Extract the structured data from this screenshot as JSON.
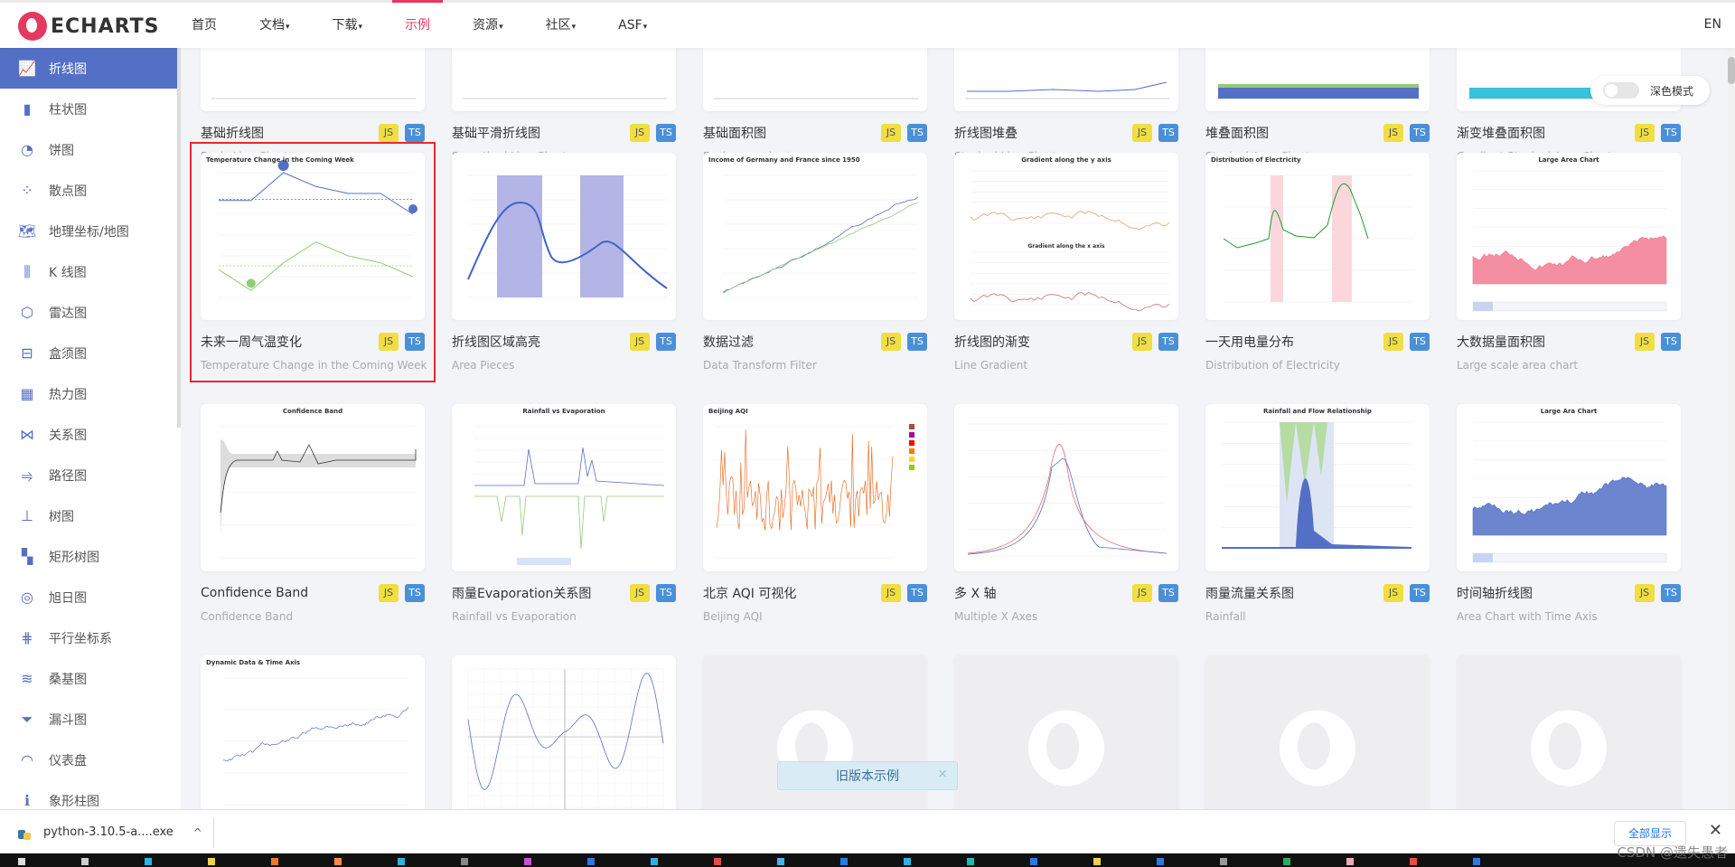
{
  "topbar": {
    "logo_text": "ECHARTS",
    "nav": [
      {
        "label": "首页",
        "caret": ""
      },
      {
        "label": "文档",
        "caret": "▾"
      },
      {
        "label": "下载",
        "caret": "▾"
      },
      {
        "label": "示例",
        "caret": "",
        "active": true
      },
      {
        "label": "资源",
        "caret": "▾"
      },
      {
        "label": "社区",
        "caret": "▾"
      },
      {
        "label": "ASF",
        "caret": "▾"
      }
    ],
    "lang": "EN"
  },
  "sidebar": {
    "items": [
      {
        "label": "折线图",
        "icon": "line-chart-icon",
        "glyph": "📈",
        "active": true
      },
      {
        "label": "柱状图",
        "icon": "bar-chart-icon",
        "glyph": "▮"
      },
      {
        "label": "饼图",
        "icon": "pie-chart-icon",
        "glyph": "◔"
      },
      {
        "label": "散点图",
        "icon": "scatter-chart-icon",
        "glyph": "⁘"
      },
      {
        "label": "地理坐标/地图",
        "icon": "map-icon",
        "glyph": "🗺"
      },
      {
        "label": "K 线图",
        "icon": "candlestick-icon",
        "glyph": "⫼"
      },
      {
        "label": "雷达图",
        "icon": "radar-icon",
        "glyph": "⬡"
      },
      {
        "label": "盒须图",
        "icon": "boxplot-icon",
        "glyph": "⊟"
      },
      {
        "label": "热力图",
        "icon": "heatmap-icon",
        "glyph": "▦"
      },
      {
        "label": "关系图",
        "icon": "graph-icon",
        "glyph": "⋈"
      },
      {
        "label": "路径图",
        "icon": "lines-icon",
        "glyph": "⥤"
      },
      {
        "label": "树图",
        "icon": "tree-icon",
        "glyph": "⊥"
      },
      {
        "label": "矩形树图",
        "icon": "treemap-icon",
        "glyph": "▚"
      },
      {
        "label": "旭日图",
        "icon": "sunburst-icon",
        "glyph": "◎"
      },
      {
        "label": "平行坐标系",
        "icon": "parallel-icon",
        "glyph": "⋕"
      },
      {
        "label": "桑基图",
        "icon": "sankey-icon",
        "glyph": "≋"
      },
      {
        "label": "漏斗图",
        "icon": "funnel-icon",
        "glyph": "⏷"
      },
      {
        "label": "仪表盘",
        "icon": "gauge-icon",
        "glyph": "◠"
      },
      {
        "label": "象形柱图",
        "icon": "pictorial-bar-icon",
        "glyph": "ℹ"
      }
    ]
  },
  "dark_mode": {
    "label": "深色模式",
    "enabled": false
  },
  "cards": [
    {
      "title": "基础折线图",
      "subtitle": "Basic Line Chart",
      "thumb": "basic-line"
    },
    {
      "title": "基础平滑折线图",
      "subtitle": "Smoothed Line Chart",
      "thumb": "smooth-line"
    },
    {
      "title": "基础面积图",
      "subtitle": "Basic area chart",
      "thumb": "basic-area"
    },
    {
      "title": "折线图堆叠",
      "subtitle": "Stacked Line Chart",
      "thumb": "stacked-line"
    },
    {
      "title": "堆叠面积图",
      "subtitle": "Stacked Area Chart",
      "thumb": "stacked-area"
    },
    {
      "title": "渐变堆叠面积图",
      "subtitle": "Gradient Stacked Area Chart",
      "thumb": "gradient-stacked"
    },
    {
      "title": "未来一周气温变化",
      "subtitle": "Temperature Change in the Coming Week",
      "thumb": "temperature",
      "thumb_title": "Temperature Change in the Coming Week",
      "selected": true
    },
    {
      "title": "折线图区域高亮",
      "subtitle": "Area Pieces",
      "thumb": "area-pieces"
    },
    {
      "title": "数据过滤",
      "subtitle": "Data Transform Filter",
      "thumb": "data-filter",
      "thumb_title": "Income of Germany and France since 1950"
    },
    {
      "title": "折线图的渐变",
      "subtitle": "Line Gradient",
      "thumb": "line-gradient",
      "thumb_title": "Gradient along the y axis"
    },
    {
      "title": "一天用电量分布",
      "subtitle": "Distribution of Electricity",
      "thumb": "electricity",
      "thumb_title": "Distribution of Electricity"
    },
    {
      "title": "大数据量面积图",
      "subtitle": "Large scale area chart",
      "thumb": "large-area",
      "thumb_title": "Large Area Chart"
    },
    {
      "title": "Confidence Band",
      "subtitle": "Confidence Band",
      "thumb": "confidence",
      "thumb_title": "Confidence Band"
    },
    {
      "title": "雨量Evaporation关系图",
      "subtitle": "Rainfall vs Evaporation",
      "thumb": "rainfall-evap",
      "thumb_title": "Rainfall vs Evaporation"
    },
    {
      "title": "北京 AQI 可视化",
      "subtitle": "Beijing AQI",
      "thumb": "aqi",
      "thumb_title": "Beijing AQI"
    },
    {
      "title": "多 X 轴",
      "subtitle": "Multiple X Axes",
      "thumb": "multi-x"
    },
    {
      "title": "雨量流量关系图",
      "subtitle": "Rainfall",
      "thumb": "rainfall-flow",
      "thumb_title": "Rainfall and Flow Relationship"
    },
    {
      "title": "时间轴折线图",
      "subtitle": "Area Chart with Time Axis",
      "thumb": "time-axis",
      "thumb_title": "Large Ara Chart"
    },
    {
      "title": "",
      "subtitle": "",
      "thumb": "dynamic",
      "thumb_title": "Dynamic Data & Time Axis"
    },
    {
      "title": "",
      "subtitle": "",
      "thumb": "function"
    },
    {
      "title": "",
      "subtitle": "",
      "thumb": "placeholder"
    },
    {
      "title": "",
      "subtitle": "",
      "thumb": "placeholder"
    },
    {
      "title": "",
      "subtitle": "",
      "thumb": "placeholder"
    },
    {
      "title": "",
      "subtitle": "",
      "thumb": "placeholder"
    }
  ],
  "badges": {
    "js": "JS",
    "ts": "TS"
  },
  "toast": {
    "text": "旧版本示例",
    "close": "×"
  },
  "download_bar": {
    "file_name": "python-3.10.5-a....exe",
    "chevron": "^",
    "show_all": "全部显示",
    "close": "✕"
  },
  "watermark": "CSDN @遗失愚者"
}
